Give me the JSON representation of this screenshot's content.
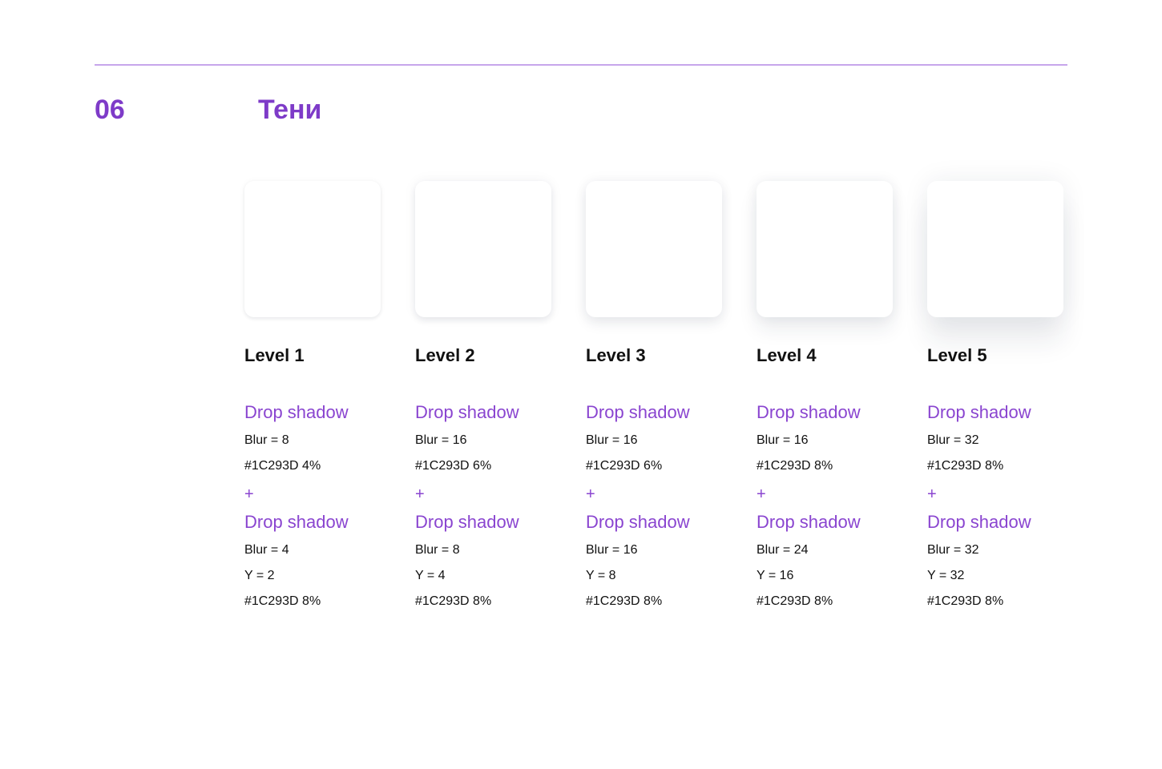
{
  "section": {
    "number": "06",
    "title": "Тени"
  },
  "colors": {
    "accent": "#7E3BC8",
    "rule": "#C7A6EB",
    "shadow_color": "#1C293D"
  },
  "levels": [
    {
      "title": "Level 1",
      "shadow1": {
        "heading": "Drop shadow",
        "blur": "Blur = 8",
        "color": "#1C293D 4%"
      },
      "plus": "+",
      "shadow2": {
        "heading": "Drop shadow",
        "blur": "Blur = 4",
        "y": "Y = 2",
        "color": "#1C293D 8%"
      }
    },
    {
      "title": "Level 2",
      "shadow1": {
        "heading": "Drop shadow",
        "blur": "Blur = 16",
        "color": "#1C293D 6%"
      },
      "plus": "+",
      "shadow2": {
        "heading": "Drop shadow",
        "blur": "Blur = 8",
        "y": "Y = 4",
        "color": "#1C293D 8%"
      }
    },
    {
      "title": "Level 3",
      "shadow1": {
        "heading": "Drop shadow",
        "blur": "Blur = 16",
        "color": "#1C293D 6%"
      },
      "plus": "+",
      "shadow2": {
        "heading": "Drop shadow",
        "blur": "Blur = 16",
        "y": "Y = 8",
        "color": "#1C293D 8%"
      }
    },
    {
      "title": "Level 4",
      "shadow1": {
        "heading": "Drop shadow",
        "blur": "Blur = 16",
        "color": "#1C293D 8%"
      },
      "plus": "+",
      "shadow2": {
        "heading": "Drop shadow",
        "blur": "Blur = 24",
        "y": "Y = 16",
        "color": "#1C293D 8%"
      }
    },
    {
      "title": "Level 5",
      "shadow1": {
        "heading": "Drop shadow",
        "blur": "Blur = 32",
        "color": "#1C293D 8%"
      },
      "plus": "+",
      "shadow2": {
        "heading": "Drop shadow",
        "blur": "Blur = 32",
        "y": "Y = 32",
        "color": "#1C293D 8%"
      }
    }
  ]
}
